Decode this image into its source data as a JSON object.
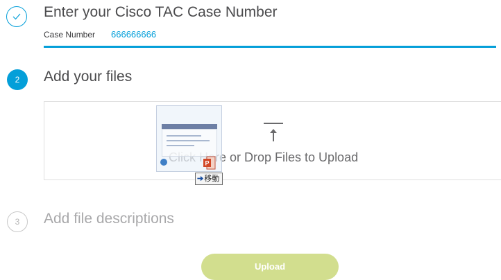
{
  "step1": {
    "title": "Enter your Cisco TAC Case Number",
    "case_label": "Case Number",
    "case_value": "666666666",
    "icon": "check-icon"
  },
  "step2": {
    "number": "2",
    "title": "Add your files",
    "dropzone_text": "Click Here or Drop Files to Upload",
    "icon": "upload-arrow-icon"
  },
  "drag_ghost": {
    "tooltip_arrow": "➔",
    "tooltip_text": "移動",
    "file_icon": "powerpoint-file-icon"
  },
  "step3": {
    "number": "3",
    "title": "Add file descriptions"
  },
  "upload_button": {
    "label": "Upload"
  },
  "colors": {
    "accent": "#049fd9",
    "upload_button_disabled": "#d2de8e",
    "text": "#4a4a4c",
    "muted_text": "#a8a8aa"
  }
}
